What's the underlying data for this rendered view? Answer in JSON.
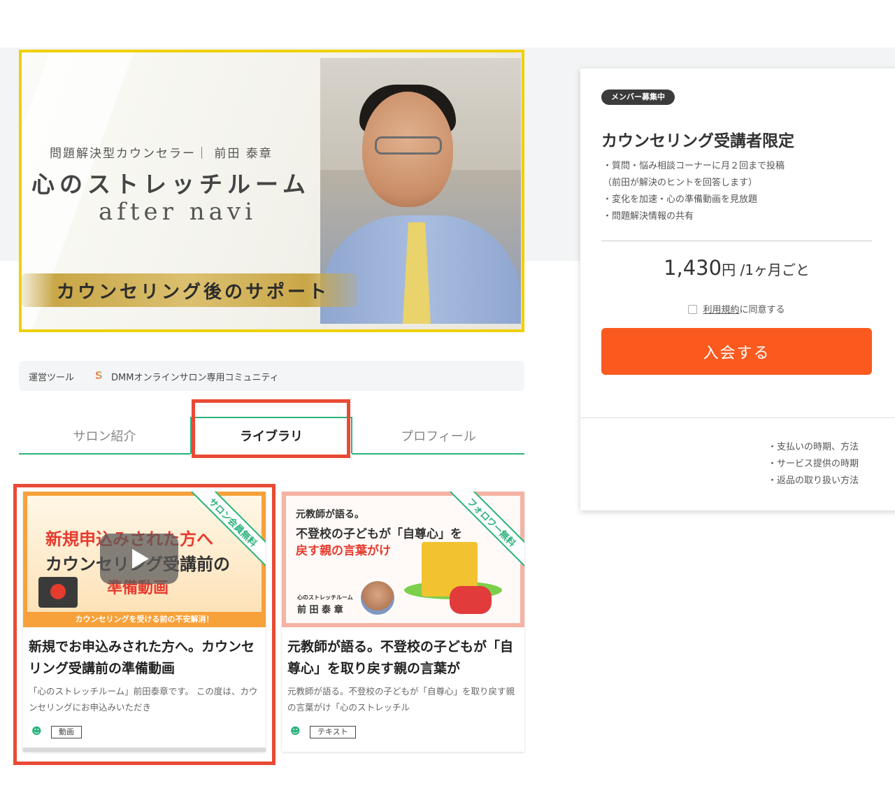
{
  "hero": {
    "tagline": "問題解決型カウンセラー｜ 前田 泰章",
    "title": "心のストレッチルーム",
    "subtitle": "after navi",
    "banner": "カウンセリング後のサポート"
  },
  "toolbar": {
    "label": "運営ツール",
    "icon": "dmm-logo-icon",
    "value": "DMMオンラインサロン専用コミュニティ"
  },
  "tabs": [
    "サロン紹介",
    "ライブラリ",
    "プロフィール"
  ],
  "active_tab": "ライブラリ",
  "cards": [
    {
      "ribbon": "サロン会員無料",
      "thumb_lines": [
        "新規申込みされた方へ",
        "カウンセリング受講前の",
        "準備動画"
      ],
      "thumb_footer": "カウンセリングを受ける前の不安解消！",
      "title": "新規でお申込みされた方へ。カウンセリング受講前の準備動画",
      "description": "「心のストレッチルーム」前田泰章です。 この度は、カウンセリングにお申込みいただき",
      "type": "動画"
    },
    {
      "ribbon": "フォロワー無料",
      "thumb_lines": [
        "元教師が語る。",
        "不登校の子どもが「自尊心」を",
        "戻す親の言葉がけ"
      ],
      "thumb_footer": "心のストレッチルーム",
      "thumb_author": "前 田 泰 章",
      "title": "元教師が語る。不登校の子どもが「自尊心」を取り戻す親の言葉が",
      "description": "元教師が語る。不登校の子どもが「自尊心」を取り戻す親の言葉がけ「心のストレッチル",
      "type": "テキスト"
    }
  ],
  "plan": {
    "badge": "メンバー募集中",
    "name": "カウンセリング受講者限定",
    "features": [
      "・質問・悩み相談コーナーに月２回まで投稿",
      "（前田が解決のヒントを回答します）",
      "・変化を加速・心の準備動画を見放題",
      "・問題解決情報の共有"
    ],
    "price": "1,430",
    "price_unit": "円 /1ヶ月ごと",
    "agree_link": "利用規約",
    "agree_text": "に同意する",
    "join_button": "入会する",
    "info_links": [
      "・支払いの時期、方法",
      "・サービス提供の時期",
      "・返品の取り扱い方法"
    ]
  },
  "colors": {
    "accent_green": "#2ab27b",
    "join_orange": "#fb5a1f",
    "highlight_red": "#e94a35",
    "hero_yellow": "#f0d000"
  }
}
